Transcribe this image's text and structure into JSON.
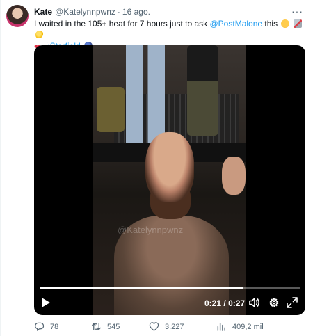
{
  "tweet": {
    "author_name": "Kate",
    "author_handle": "@Katelynnpwnz",
    "separator": "·",
    "date": "16 ago.",
    "text_before": "I waited in the 105+ heat for 7 hours just to ask ",
    "mention": "@PostMalone",
    "text_after": " this",
    "hashtag": "#Starfield",
    "more_label": "···"
  },
  "media": {
    "watermark": "@Katelynnpwnz",
    "time_current": "0:21",
    "time_total": "0:27",
    "time_separator": "/",
    "progress": 0.78
  },
  "actions": {
    "replies": "78",
    "retweets": "545",
    "likes": "3.227",
    "views": "409,2 mil"
  },
  "colors": {
    "link": "#1d9bf0",
    "secondary_text": "#536471"
  }
}
